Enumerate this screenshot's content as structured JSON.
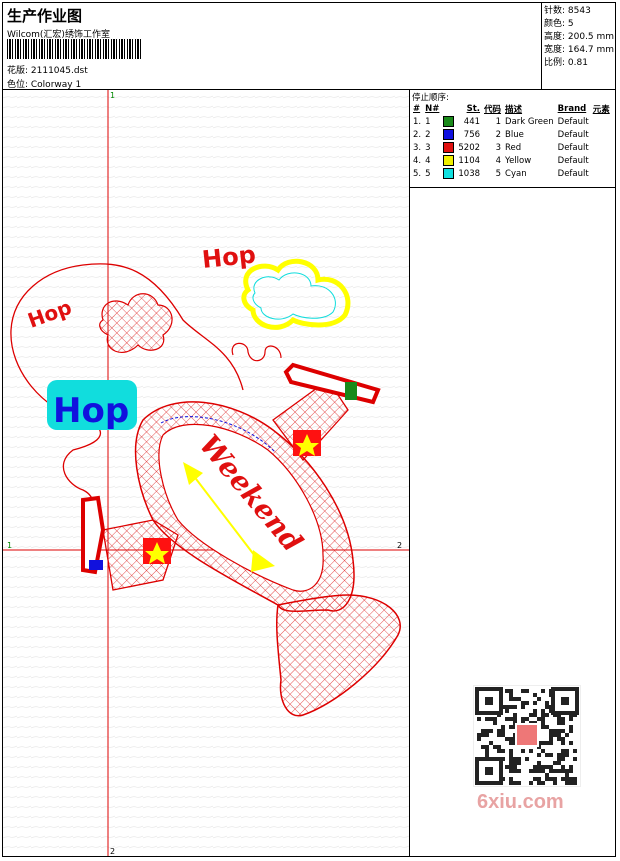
{
  "header": {
    "title": "生产作业图",
    "company": "Wilcom(汇宏)绣饰工作室",
    "design_label": "花版: 2111045.dst",
    "colorway_label": "色位: Colorway 1"
  },
  "stats": {
    "stitches": "针数: 8543",
    "colors": "颜色: 5",
    "height": "高度: 200.5 mm",
    "width": "宽度: 164.7 mm",
    "scale": "比例: 0.81"
  },
  "canvas": {
    "axis_top": "1",
    "axis_bottom": "2",
    "axis_left": "1",
    "axis_right": "2"
  },
  "stop_sequence": {
    "title": "停止顺序:",
    "headers": [
      "#",
      "N#",
      "St.",
      "代码",
      "描述",
      "Brand",
      "元素"
    ],
    "rows": [
      {
        "num": "1.",
        "n": "1",
        "color": "#1a8a1a",
        "st": "441",
        "code": "1",
        "desc": "Dark Green",
        "brand": "Default"
      },
      {
        "num": "2.",
        "n": "2",
        "color": "#1010e0",
        "st": "756",
        "code": "2",
        "desc": "Blue",
        "brand": "Default"
      },
      {
        "num": "3.",
        "n": "3",
        "color": "#e01010",
        "st": "5202",
        "code": "3",
        "desc": "Red",
        "brand": "Default"
      },
      {
        "num": "4.",
        "n": "4",
        "color": "#f0f000",
        "st": "1104",
        "code": "4",
        "desc": "Yellow",
        "brand": "Default"
      },
      {
        "num": "5.",
        "n": "5",
        "color": "#10e0e0",
        "st": "1038",
        "code": "5",
        "desc": "Cyan",
        "brand": "Default"
      }
    ]
  },
  "art_text": {
    "hop_top": "Hop",
    "hop_left": "Hop",
    "hop_cyan": "Hop",
    "weekend": "Weekend"
  },
  "watermark": "6xiu.com"
}
